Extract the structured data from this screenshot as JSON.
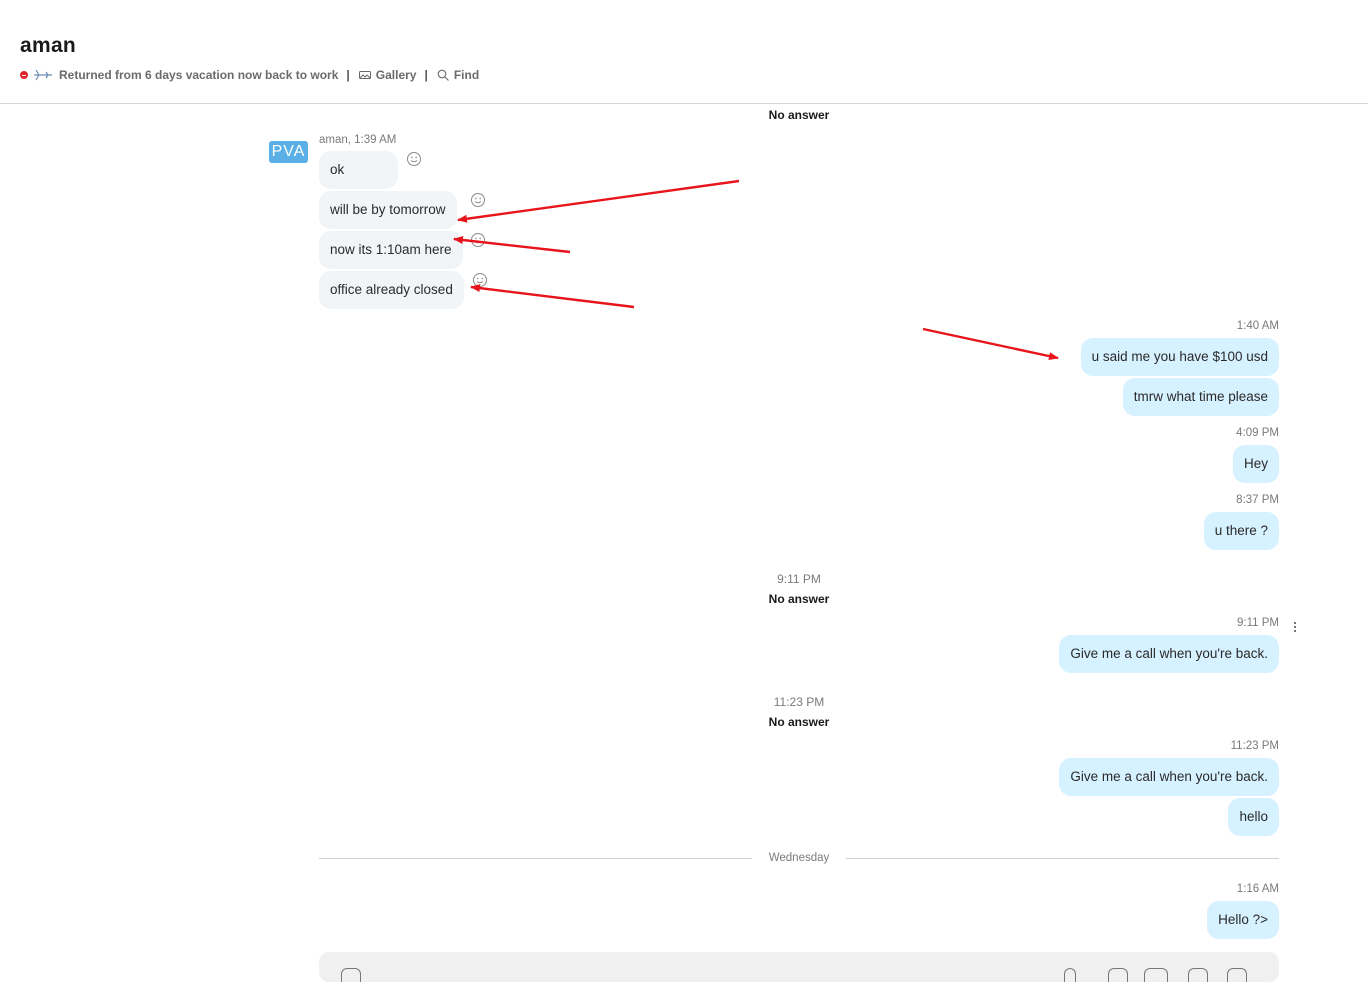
{
  "header": {
    "title": "aman",
    "status_message": "Returned from 6 days vacation now back to work",
    "separator": "|",
    "gallery_label": "Gallery",
    "find_label": "Find",
    "status_color": "#e0262c"
  },
  "calls": [
    {
      "time": "",
      "text": "No answer"
    },
    {
      "time": "9:11 PM",
      "text": "No answer"
    },
    {
      "time": "11:23 PM",
      "text": "No answer"
    }
  ],
  "incoming": {
    "avatar_text": "PVA",
    "sender_line": "aman, 1:39 AM",
    "messages": [
      "ok",
      "will be by tomorrow",
      "now its 1:10am here",
      "office already closed"
    ]
  },
  "outgoing_groups": [
    {
      "time": "1:40 AM",
      "messages": [
        "u said me you have $100 usd",
        "tmrw what time please"
      ]
    },
    {
      "time": "4:09 PM",
      "messages": [
        "Hey"
      ]
    },
    {
      "time": "8:37 PM",
      "messages": [
        "u there ?"
      ]
    },
    {
      "time": "9:11 PM",
      "messages": [
        "Give me a call when you're back."
      ]
    },
    {
      "time": "11:23 PM",
      "messages": [
        "Give me a call when you're back.",
        "hello"
      ]
    },
    {
      "time": "1:16 AM",
      "messages": [
        "Hello ?>"
      ]
    }
  ],
  "date_divider": "Wednesday",
  "colors": {
    "incoming_bubble": "#f2f5f8",
    "outgoing_bubble": "#d6f1ff",
    "avatar": "#5ab0e6",
    "annotation_arrow": "#e8141b"
  }
}
